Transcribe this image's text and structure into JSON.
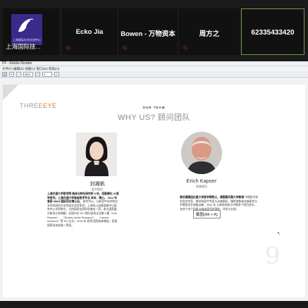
{
  "meeting": {
    "tiles": [
      {
        "name": "上海国际技...",
        "logo_text": "上海国际技术交流中心"
      },
      {
        "name": "Ecko Jia"
      },
      {
        "name": "Bowen - 万物资本"
      },
      {
        "name": "周方之"
      },
      {
        "name": "62335433420"
      }
    ],
    "mic_muted_icon": "mic-muted-icon"
  },
  "reader": {
    "title": "PF - Adobe Reader",
    "menu": "文件(F)  编辑(E)  视图(V)  窗口(W)  帮助(H)",
    "zoom": "38%",
    "page_field": "9"
  },
  "slide": {
    "brand_prefix": "THREE",
    "brand_suffix": "EYE",
    "team_label": "OUR TEAM",
    "heading": "WHY US?  顾问团队",
    "advisor_f": {
      "name": "刘湘帆",
      "role": "医学顾问",
      "bio_bold": "上海交通大学医学院 临床与转化研究所 II 任，冠脉硬化 III 医学研究。上海交通大学临床医学专业 本科、博士。",
      "bio_bold2": "2012 年 曾获 IIIIAS 国际顶尖博士后。",
      "bio": "研究中心，以新型中间学和交叉学科研究方法完成交叉性项目。上海市心血管疾病中心研究中心学科带头，主持国家自然科学基金一项，参与国家重点研发计划课题，在国内外 SCI 期刊发表论文数十篇（Cell Reports）、（Nucleic Acids Research）、（cancer research）等 SCI 论文，2018 年 获得 国家临床基金，获批国家科技成果二等奖。"
    },
    "advisor_m": {
      "name": "Erich Kapser",
      "role": "首席顾问",
      "bio_bold": "曾任德国纽伦堡大学医学院院士，德国慕尼黑大学教授",
      "bio": "中德医学科学合作专家、跨学科医疗专家与法律顾问、慢性病和老年病研究与中德医学交流推动者、2000 年 以来持续参与中德多个项目合作，支持十余个科研与临床项目的落地、评估与交流。"
    },
    "tooltip": "截图(Alt + A)",
    "page_number": "9"
  },
  "colors": {
    "accent_orange": "#e07a2e",
    "active_border": "#6f9e3b",
    "mic_red": "#d9392b",
    "logo_purple": "#3c2a8a"
  }
}
